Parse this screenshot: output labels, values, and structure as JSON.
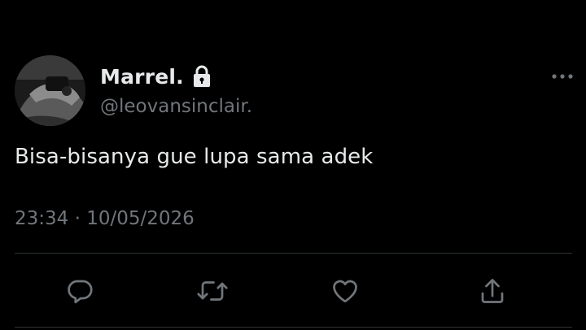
{
  "tweet": {
    "display_name": "Marrel.",
    "handle": "@leovansinclair.",
    "text": "Bisa-bisanya gue lupa sama adek",
    "timestamp": "23:34 · 10/05/2026",
    "protected_account": true
  },
  "icons": {
    "lock": "lock-icon",
    "more": "more-icon",
    "reply": "reply-icon",
    "retweet": "retweet-icon",
    "like": "like-icon",
    "share": "share-icon"
  },
  "colors": {
    "background": "#000000",
    "primary_text": "#e7e9ea",
    "secondary_text": "#71767b",
    "divider": "#2f3336"
  }
}
